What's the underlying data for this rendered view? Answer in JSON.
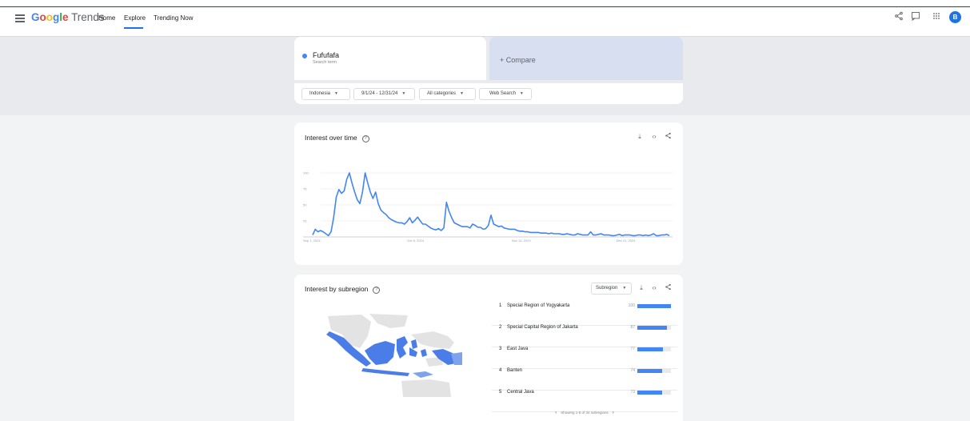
{
  "header": {
    "logo_google": "Google",
    "logo_trends": "Trends",
    "nav": [
      "Home",
      "Explore",
      "Trending Now"
    ],
    "avatar_letter": "B",
    "icons": [
      "share-icon",
      "feedback-icon",
      "apps-icon"
    ]
  },
  "search": {
    "term": "Fufufafa",
    "term_type": "Search term",
    "term_color": "#4285f4",
    "compare_label": "+   Compare",
    "filters": [
      "Indonesia",
      "9/1/24 - 12/31/24",
      "All categories",
      "Web Search"
    ]
  },
  "interest_over_time": {
    "title": "Interest over time",
    "chart_data": {
      "type": "line",
      "x_tick_labels": [
        "Sep 1, 2024",
        "Oct 8, 2024",
        "Nov 14, 2024",
        "Dec 21, 2024"
      ],
      "y_tick_labels": [
        "100",
        "75",
        "50",
        "25"
      ],
      "ylim": [
        0,
        100
      ],
      "grid": true,
      "series": [
        {
          "color": "#4285f4",
          "values": [
            3,
            12,
            8,
            10,
            8,
            5,
            2,
            8,
            30,
            62,
            74,
            68,
            72,
            90,
            100,
            84,
            70,
            58,
            52,
            70,
            100,
            84,
            70,
            60,
            70,
            52,
            42,
            38,
            35,
            30,
            27,
            25,
            23,
            22,
            22,
            20,
            24,
            30,
            22,
            26,
            31,
            25,
            20,
            20,
            17,
            14,
            12,
            11,
            13,
            10,
            14,
            54,
            40,
            30,
            22,
            20,
            18,
            16,
            16,
            16,
            14,
            20,
            18,
            15,
            15,
            12,
            13,
            18,
            34,
            20,
            18,
            16,
            17,
            14,
            13,
            12,
            12,
            12,
            10,
            9,
            9,
            8,
            8,
            7,
            7,
            7,
            7,
            6,
            6,
            6,
            5,
            6,
            5,
            5,
            5,
            4,
            4,
            5,
            4,
            3,
            3,
            5,
            4,
            3,
            3,
            3,
            8,
            3,
            3,
            4,
            5,
            3,
            3,
            3,
            2,
            2,
            3,
            4,
            2,
            3,
            3,
            3,
            2,
            2,
            3,
            3,
            2,
            3,
            2,
            3,
            5,
            2,
            2,
            3,
            3,
            4,
            2
          ]
        }
      ]
    }
  },
  "interest_by_subregion": {
    "title": "Interest by subregion",
    "selector_label": "Subregion",
    "rows": [
      {
        "rank": "1",
        "name": "Special Region of Yogyakarta",
        "value": "100",
        "fraction": 1.0
      },
      {
        "rank": "2",
        "name": "Special Capital Region of Jakarta",
        "value": "87",
        "fraction": 0.87
      },
      {
        "rank": "3",
        "name": "East Java",
        "value": "77",
        "fraction": 0.77
      },
      {
        "rank": "4",
        "name": "Banten",
        "value": "74",
        "fraction": 0.74
      },
      {
        "rank": "5",
        "name": "Central Java",
        "value": "73",
        "fraction": 0.73
      }
    ],
    "pager_text": "Showing 1-5 of 34 subregions"
  }
}
